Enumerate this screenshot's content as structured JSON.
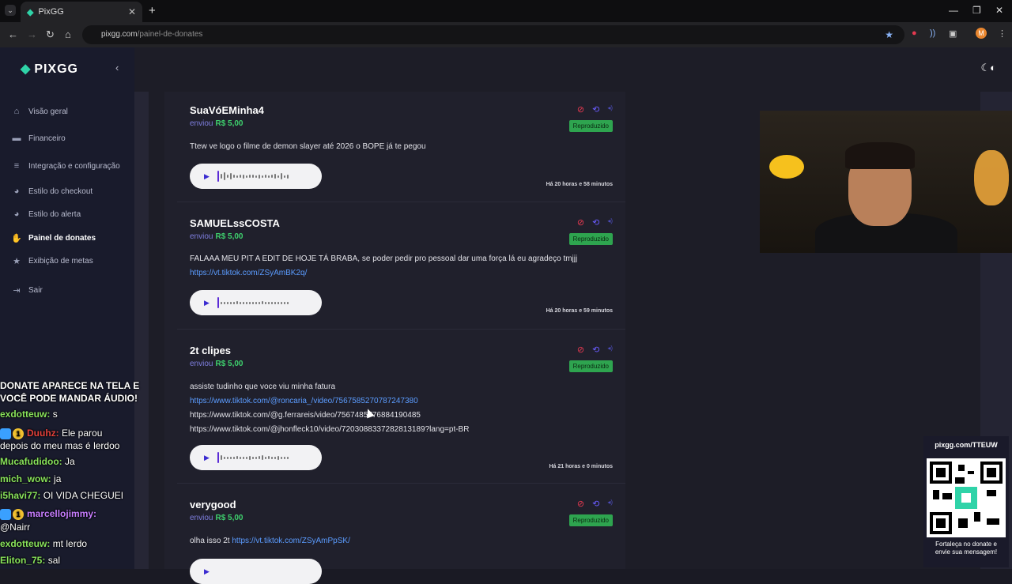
{
  "browser": {
    "tab_title": "PixGG",
    "url_host": "pixgg.com",
    "url_path": "/painel-de-donates",
    "profile_initial": "M"
  },
  "sidebar": {
    "brand": "PIXGG",
    "items": [
      {
        "label": "Visão geral",
        "icon": "home-icon"
      },
      {
        "label": "Financeiro",
        "icon": "wallet-icon"
      },
      {
        "label": "Integração e configuração",
        "icon": "settings-icon"
      },
      {
        "label": "Estilo do checkout",
        "icon": "palette-icon"
      },
      {
        "label": "Estilo do alerta",
        "icon": "palette-icon"
      },
      {
        "label": "Painel de donates",
        "icon": "donation-icon"
      },
      {
        "label": "Exibição de metas",
        "icon": "star-icon"
      },
      {
        "label": "Sair",
        "icon": "logout-icon"
      }
    ],
    "active_index": 5
  },
  "donations": [
    {
      "name": "SuaVóEMinha4",
      "sent_label": "enviou",
      "amount": "R$ 5,00",
      "status": "Reproduzido",
      "message": "Ttew ve logo o filme de demon slayer até 2026 o BOPE já te pegou",
      "time": "Há 20 horas e 58 minutos"
    },
    {
      "name": "SAMUELssCOSTA",
      "sent_label": "enviou",
      "amount": "R$ 5,00",
      "status": "Reproduzido",
      "message": "FALAAA MEU PIT A EDIT DE HOJE TÁ BRABA, se poder pedir pro pessoal dar uma força lá eu agradeço tmjjj",
      "link": "https://vt.tiktok.com/ZSyAmBK2q/",
      "time": "Há 20 horas e 59 minutos"
    },
    {
      "name": "2t clipes",
      "sent_label": "enviou",
      "amount": "R$ 5,00",
      "status": "Reproduzido",
      "message": "assiste tudinho que voce viu minha fatura",
      "link": "https://www.tiktok.com/@roncaria_/video/7567585270787247380",
      "line2": "https://www.tiktok.com/@g.ferrareis/video/7567485776884190485",
      "line3": "https://www.tiktok.com/@jhonfleck10/video/7203088337282813189?lang=pt-BR",
      "time": "Há 21 horas e 0 minutos"
    },
    {
      "name": "verygood",
      "sent_label": "enviou",
      "amount": "R$ 5,00",
      "status": "Reproduzido",
      "message": "olha isso 2t",
      "link": "https://vt.tiktok.com/ZSyAmPpSK/"
    }
  ],
  "chat": {
    "banner1": "DONATE APARECE NA TELA E",
    "banner2": "VOCÊ PODE MANDAR ÁUDIO!",
    "messages": [
      {
        "user": "exdotteuw:",
        "text": "s"
      },
      {
        "user": "Duuhz:",
        "text": "Ele parou"
      },
      {
        "user": "",
        "text": "depois do meu mas é lerdoo"
      },
      {
        "user": "Mucafudidoo:",
        "text": "Ja"
      },
      {
        "user": "mich_wow:",
        "text": "ja"
      },
      {
        "user": "i5havi77:",
        "text": "OI VIDA CHEGUEI"
      },
      {
        "user": "marcellojimmy:",
        "text": ""
      },
      {
        "user": "",
        "text": "@Nairr"
      },
      {
        "user": "exdotteuw:",
        "text": "mt lerdo"
      },
      {
        "user": "Eliton_75:",
        "text": "sal"
      }
    ]
  },
  "qr_panel": {
    "url": "pixgg.com/TTEUW",
    "caption1": "Fortaleça no donate e",
    "caption2": "envie sua mensagem!"
  },
  "colors": {
    "accent": "#2fd3a8",
    "amount": "#3ecf6d",
    "badge": "#2ea44f",
    "link": "#5b9cff",
    "block": "#e53950"
  }
}
